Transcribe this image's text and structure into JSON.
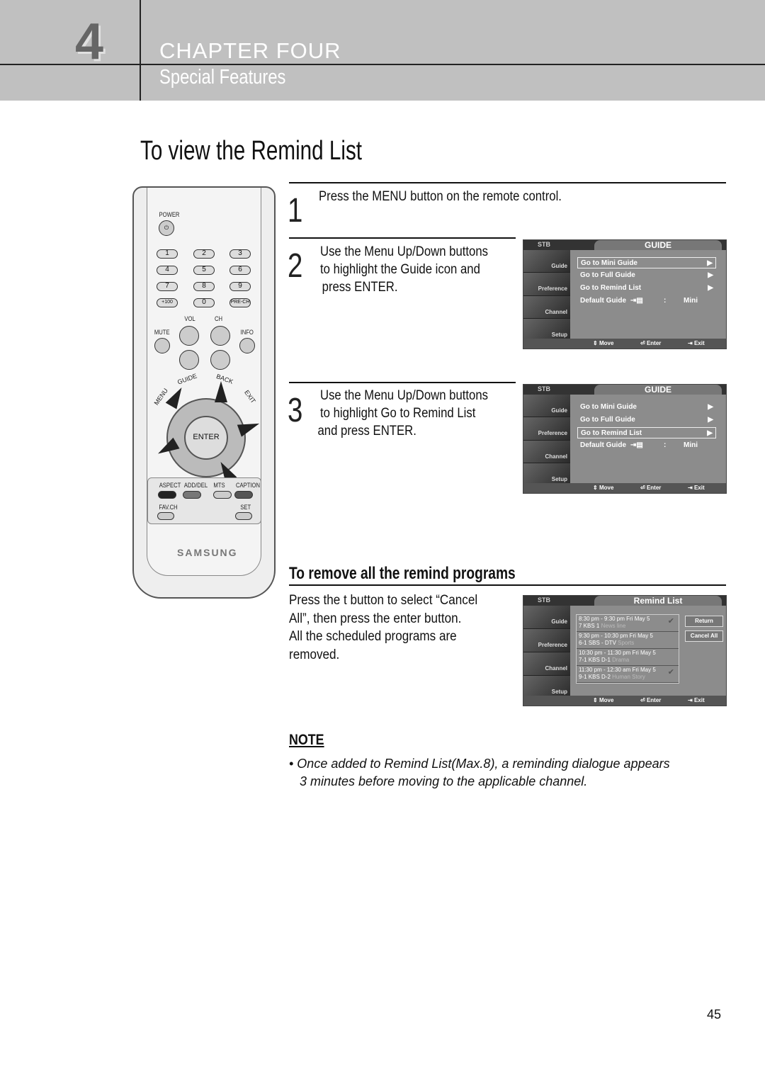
{
  "header": {
    "chapter_number": "4",
    "chapter_title": "CHAPTER FOUR",
    "section": "Special Features"
  },
  "page_title": "To view the Remind List",
  "steps": [
    {
      "num": "1",
      "lines": [
        "Press the MENU button on the remote control."
      ]
    },
    {
      "num": "2",
      "lines": [
        "Use the Menu Up/Down buttons",
        "to highlight the Guide icon and",
        "press ENTER."
      ]
    },
    {
      "num": "3",
      "lines": [
        "Use the Menu Up/Down buttons",
        "to highlight Go to Remind List",
        "and press ENTER."
      ]
    }
  ],
  "remote": {
    "power": "POWER",
    "keys": [
      "1",
      "2",
      "3",
      "4",
      "5",
      "6",
      "7",
      "8",
      "9",
      "+100",
      "0",
      "PRE-CH"
    ],
    "vol": "VOL",
    "ch": "CH",
    "mute": "MUTE",
    "info": "INFO",
    "guide": "GUIDE",
    "back": "BACK",
    "menu": "MENU",
    "exit": "EXIT",
    "enter": "ENTER",
    "func": [
      "ASPECT",
      "ADD/DEL",
      "MTS",
      "CAPTION"
    ],
    "favch": "FAV.CH",
    "set": "SET",
    "brand": "SAMSUNG",
    "func_colors": [
      "#222222",
      "#777777",
      "#cccccc",
      "#555555"
    ]
  },
  "screens": {
    "stb": "STB",
    "sidebar": [
      "Guide",
      "Preference",
      "Channel",
      "Setup"
    ],
    "footer": {
      "move": "Move",
      "enter": "Enter",
      "exit": "Exit"
    },
    "guide": {
      "title": "GUIDE",
      "items": [
        "Go to Mini Guide",
        "Go to Full Guide",
        "Go to Remind List"
      ],
      "default_label": "Default Guide",
      "default_sep": ":",
      "default_value": "Mini"
    },
    "guide_selected": [
      0,
      2
    ],
    "remind": {
      "title": "Remind List",
      "rows": [
        {
          "time": "8:30 pm - 9:30 pm Fri May 5",
          "channel": "7  KBS 1",
          "program": "News line",
          "checked": true
        },
        {
          "time": "9:30 pm - 10:30 pm Fri May 5",
          "channel": "6-1  SBS - DTV",
          "program": "Sports",
          "checked": false
        },
        {
          "time": "10:30 pm - 11:30 pm Fri May 5",
          "channel": "7-1  KBS  D-1",
          "program": "Drama",
          "checked": false
        },
        {
          "time": "11:30 pm - 12:30 am Fri May 5",
          "channel": "9-1  KBS  D-2",
          "program": "Human Story",
          "checked": true
        }
      ],
      "return": "Return",
      "cancel_all": "Cancel All"
    }
  },
  "remove": {
    "heading": "To remove all the remind programs",
    "lines": [
      "Press the t button to select “Cancel",
      "All”, then press the enter button.",
      "All the scheduled programs are",
      "removed."
    ]
  },
  "note": {
    "label": "NOTE",
    "lines": [
      "• Once added to Remind List(Max.8), a reminding dialogue appears",
      "   3 minutes before moving to the applicable channel."
    ]
  },
  "page_number": "45"
}
